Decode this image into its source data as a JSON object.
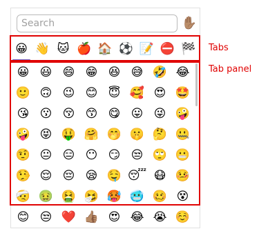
{
  "search": {
    "placeholder": "Search",
    "value": ""
  },
  "skin_tone_button": {
    "glyph": "✋🏽",
    "icon": "hand-icon"
  },
  "tabs": [
    {
      "glyph": "😀",
      "name": "smileys"
    },
    {
      "glyph": "👋",
      "name": "people"
    },
    {
      "glyph": "🐱",
      "name": "animals"
    },
    {
      "glyph": "🍎",
      "name": "food"
    },
    {
      "glyph": "🏠",
      "name": "travel"
    },
    {
      "glyph": "⚽",
      "name": "activities"
    },
    {
      "glyph": "📝",
      "name": "objects"
    },
    {
      "glyph": "⛔",
      "name": "symbols"
    },
    {
      "glyph": "🏁",
      "name": "flags"
    }
  ],
  "annotations": {
    "tabs_label": "Tabs",
    "panel_label": "Tab panel"
  },
  "panel_emojis": [
    "😀",
    "😃",
    "😄",
    "😁",
    "😆",
    "😅",
    "🤣",
    "😂",
    "🙂",
    "🙃",
    "😉",
    "😊",
    "😇",
    "🥰",
    "😍",
    "🤩",
    "😘",
    "😗",
    "😚",
    "😙",
    "😋",
    "😛",
    "😜",
    "🤪",
    "🤪",
    "😝",
    "🤑",
    "🤗",
    "🤭",
    "🤫",
    "🤔",
    "🤐",
    "🤨",
    "😐",
    "😑",
    "😶",
    "😏",
    "😒",
    "🙄",
    "😬",
    "🤥",
    "😌",
    "😔",
    "😪",
    "🤤",
    "😴",
    "😷",
    "🤒",
    "🤕",
    "🤢",
    "🤮",
    "🤧",
    "🥵",
    "🥶",
    "🥴",
    "😵"
  ],
  "footer_emojis": [
    "😊",
    "😒",
    "❤️",
    "👍🏽",
    "😍",
    "😂",
    "😭",
    "☺️"
  ]
}
